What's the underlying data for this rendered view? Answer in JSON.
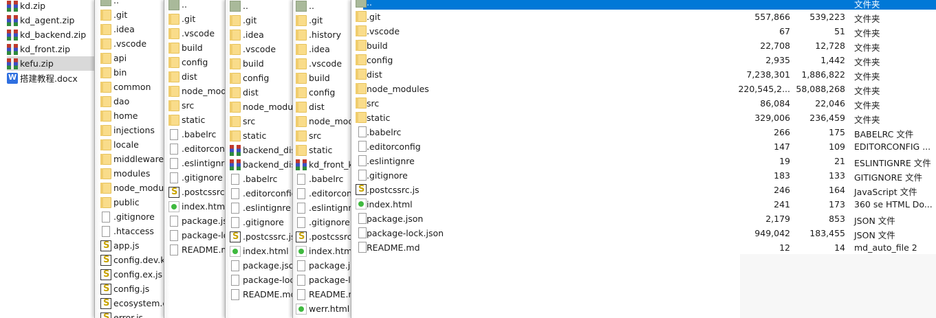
{
  "pane1": {
    "selected": 4,
    "items": [
      {
        "n": "kd.zip",
        "i": "zip"
      },
      {
        "n": "kd_agent.zip",
        "i": "zip"
      },
      {
        "n": "kd_backend.zip",
        "i": "zip"
      },
      {
        "n": "kd_front.zip",
        "i": "zip"
      },
      {
        "n": "kefu.zip",
        "i": "zip"
      },
      {
        "n": "搭建教程.docx",
        "i": "doc"
      }
    ]
  },
  "pane2": {
    "items": [
      {
        "n": "..",
        "i": "up"
      },
      {
        "n": ".git",
        "i": "folder"
      },
      {
        "n": ".idea",
        "i": "folder"
      },
      {
        "n": ".vscode",
        "i": "folder"
      },
      {
        "n": "api",
        "i": "folder"
      },
      {
        "n": "bin",
        "i": "folder"
      },
      {
        "n": "common",
        "i": "folder"
      },
      {
        "n": "dao",
        "i": "folder"
      },
      {
        "n": "home",
        "i": "folder"
      },
      {
        "n": "injections",
        "i": "folder"
      },
      {
        "n": "locale",
        "i": "folder"
      },
      {
        "n": "middlewares",
        "i": "folder"
      },
      {
        "n": "modules",
        "i": "folder"
      },
      {
        "n": "node_modules",
        "i": "folder"
      },
      {
        "n": "public",
        "i": "folder"
      },
      {
        "n": ".gitignore",
        "i": "file"
      },
      {
        "n": ".htaccess",
        "i": "file"
      },
      {
        "n": "app.js",
        "i": "js"
      },
      {
        "n": "config.dev.kd",
        "i": "js"
      },
      {
        "n": "config.ex.js",
        "i": "js"
      },
      {
        "n": "config.js",
        "i": "js"
      },
      {
        "n": "ecosystem.co",
        "i": "js"
      },
      {
        "n": "error.js",
        "i": "js"
      }
    ]
  },
  "pane3": {
    "items": [
      {
        "n": "..",
        "i": "up"
      },
      {
        "n": ".git",
        "i": "folder"
      },
      {
        "n": ".vscode",
        "i": "folder"
      },
      {
        "n": "build",
        "i": "folder"
      },
      {
        "n": "config",
        "i": "folder"
      },
      {
        "n": "dist",
        "i": "folder"
      },
      {
        "n": "node_modules",
        "i": "folder"
      },
      {
        "n": "src",
        "i": "folder"
      },
      {
        "n": "static",
        "i": "folder"
      },
      {
        "n": ".babelrc",
        "i": "file"
      },
      {
        "n": ".editorconfig",
        "i": "file"
      },
      {
        "n": ".eslintignre",
        "i": "file"
      },
      {
        "n": ".gitignore",
        "i": "file"
      },
      {
        "n": ".postcssrc.js",
        "i": "js"
      },
      {
        "n": "index.html",
        "i": "html"
      },
      {
        "n": "package.json",
        "i": "file"
      },
      {
        "n": "package-lock.json",
        "i": "file"
      },
      {
        "n": "README.md",
        "i": "file"
      }
    ]
  },
  "pane4": {
    "items": [
      {
        "n": "..",
        "i": "up"
      },
      {
        "n": ".git",
        "i": "folder"
      },
      {
        "n": ".idea",
        "i": "folder"
      },
      {
        "n": ".vscode",
        "i": "folder"
      },
      {
        "n": "build",
        "i": "folder"
      },
      {
        "n": "config",
        "i": "folder"
      },
      {
        "n": "dist",
        "i": "folder"
      },
      {
        "n": "node_modules",
        "i": "folder"
      },
      {
        "n": "src",
        "i": "folder"
      },
      {
        "n": "static",
        "i": "folder"
      },
      {
        "n": "backend_dist",
        "i": "zip"
      },
      {
        "n": "backend_dist",
        "i": "zip"
      },
      {
        "n": ".babelrc",
        "i": "file"
      },
      {
        "n": ".editorconfig",
        "i": "file"
      },
      {
        "n": ".eslintignre",
        "i": "file"
      },
      {
        "n": ".gitignore",
        "i": "file"
      },
      {
        "n": ".postcssrc.js",
        "i": "js"
      },
      {
        "n": "index.html",
        "i": "html"
      },
      {
        "n": "package.json",
        "i": "file"
      },
      {
        "n": "package-lock",
        "i": "file"
      },
      {
        "n": "README.md",
        "i": "file"
      }
    ]
  },
  "pane5": {
    "items": [
      {
        "n": "..",
        "i": "up"
      },
      {
        "n": ".git",
        "i": "folder"
      },
      {
        "n": ".history",
        "i": "folder"
      },
      {
        "n": ".idea",
        "i": "folder"
      },
      {
        "n": ".vscode",
        "i": "folder"
      },
      {
        "n": "build",
        "i": "folder"
      },
      {
        "n": "config",
        "i": "folder"
      },
      {
        "n": "dist",
        "i": "folder"
      },
      {
        "n": "node_modules",
        "i": "folder"
      },
      {
        "n": "src",
        "i": "folder"
      },
      {
        "n": "static",
        "i": "folder"
      },
      {
        "n": "kd_front_k",
        "i": "zip"
      },
      {
        "n": ".babelrc",
        "i": "file"
      },
      {
        "n": ".editorconfig",
        "i": "file"
      },
      {
        "n": ".eslintignre",
        "i": "file"
      },
      {
        "n": ".gitignore",
        "i": "file"
      },
      {
        "n": ".postcssrc.js",
        "i": "js"
      },
      {
        "n": "index.html",
        "i": "html"
      },
      {
        "n": "package.json",
        "i": "file"
      },
      {
        "n": "package-lock",
        "i": "file"
      },
      {
        "n": "README.md",
        "i": "file"
      },
      {
        "n": "werr.html",
        "i": "html"
      }
    ]
  },
  "main": {
    "items": [
      {
        "n": "..",
        "i": "up",
        "s": "",
        "p": "",
        "t": "文件夹"
      },
      {
        "n": ".git",
        "i": "folder",
        "s": "557,866",
        "p": "539,223",
        "t": "文件夹"
      },
      {
        "n": ".vscode",
        "i": "folder",
        "s": "67",
        "p": "51",
        "t": "文件夹"
      },
      {
        "n": "build",
        "i": "folder",
        "s": "22,708",
        "p": "12,728",
        "t": "文件夹"
      },
      {
        "n": "config",
        "i": "folder",
        "s": "2,935",
        "p": "1,442",
        "t": "文件夹"
      },
      {
        "n": "dist",
        "i": "folder",
        "s": "7,238,301",
        "p": "1,886,822",
        "t": "文件夹"
      },
      {
        "n": "node_modules",
        "i": "folder",
        "s": "220,545,2...",
        "p": "58,088,268",
        "t": "文件夹"
      },
      {
        "n": "src",
        "i": "folder",
        "s": "86,084",
        "p": "22,046",
        "t": "文件夹"
      },
      {
        "n": "static",
        "i": "folder",
        "s": "329,006",
        "p": "236,459",
        "t": "文件夹"
      },
      {
        "n": ".babelrc",
        "i": "file",
        "s": "266",
        "p": "175",
        "t": "BABELRC 文件"
      },
      {
        "n": ".editorconfig",
        "i": "file",
        "s": "147",
        "p": "109",
        "t": "EDITORCONFIG ..."
      },
      {
        "n": ".eslintignre",
        "i": "file",
        "s": "19",
        "p": "21",
        "t": "ESLINTIGNRE 文件"
      },
      {
        "n": ".gitignore",
        "i": "file",
        "s": "183",
        "p": "133",
        "t": "GITIGNORE 文件"
      },
      {
        "n": ".postcssrc.js",
        "i": "js",
        "s": "246",
        "p": "164",
        "t": "JavaScript 文件"
      },
      {
        "n": "index.html",
        "i": "html",
        "s": "241",
        "p": "173",
        "t": "360 se HTML Do..."
      },
      {
        "n": "package.json",
        "i": "file",
        "s": "2,179",
        "p": "853",
        "t": "JSON 文件"
      },
      {
        "n": "package-lock.json",
        "i": "file",
        "s": "949,042",
        "p": "183,455",
        "t": "JSON 文件"
      },
      {
        "n": "README.md",
        "i": "file",
        "s": "12",
        "p": "14",
        "t": "md_auto_file   2"
      }
    ]
  }
}
